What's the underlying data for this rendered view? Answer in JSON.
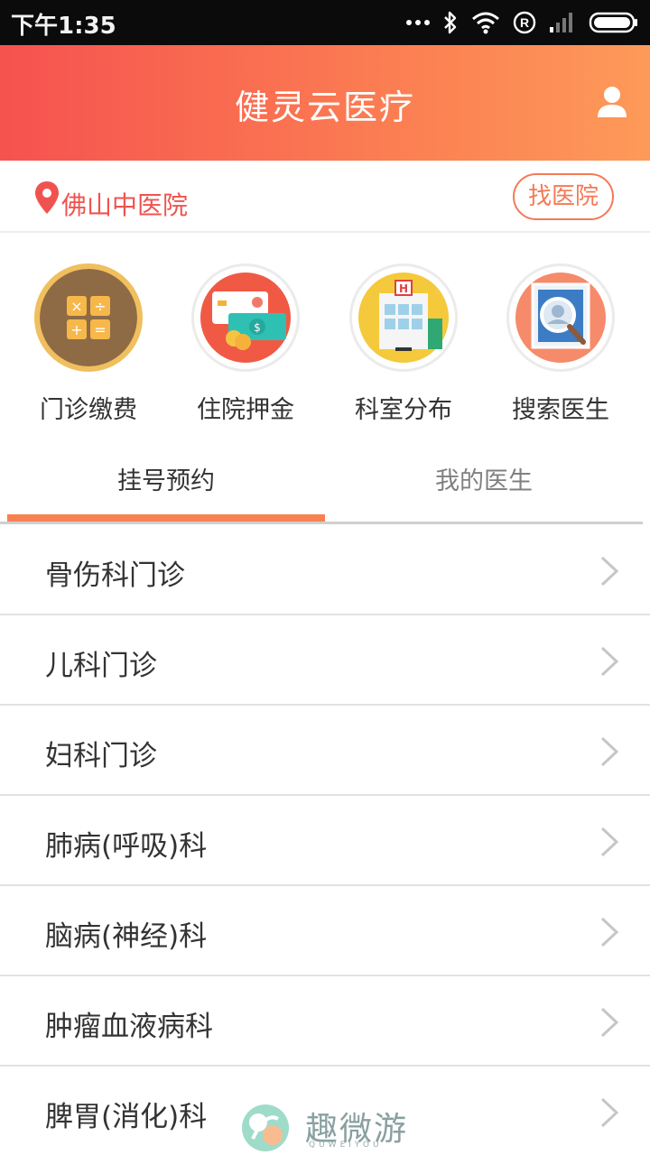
{
  "status_bar": {
    "time": "下午1:35",
    "icons": [
      "dots-icon",
      "bluetooth-icon",
      "wifi-icon",
      "registered-icon",
      "signal-icon",
      "battery-icon"
    ]
  },
  "header": {
    "title": "健灵云医疗",
    "profile_icon": "user-icon"
  },
  "location": {
    "icon": "map-pin-icon",
    "hospital": "佛山中医院",
    "find_button": "找医院"
  },
  "services": [
    {
      "label": "门诊缴费",
      "icon": "calculator-icon"
    },
    {
      "label": "住院押金",
      "icon": "card-cash-icon"
    },
    {
      "label": "科室分布",
      "icon": "hospital-building-icon"
    },
    {
      "label": "搜索医生",
      "icon": "doctor-search-icon"
    }
  ],
  "tabs": [
    {
      "label": "挂号预约",
      "active": true
    },
    {
      "label": "我的医生",
      "active": false
    }
  ],
  "departments": [
    "骨伤科门诊",
    "儿科门诊",
    "妇科门诊",
    "肺病(呼吸)科",
    "脑病(神经)科",
    "肿瘤血液病科",
    "脾胃(消化)科"
  ],
  "watermark": {
    "text": "趣微游",
    "sub": "QUWEIYOU"
  },
  "colors": {
    "header_start": "#f6524f",
    "header_end": "#fd9a59",
    "accent": "#f88152",
    "location_text": "#f0534f"
  }
}
